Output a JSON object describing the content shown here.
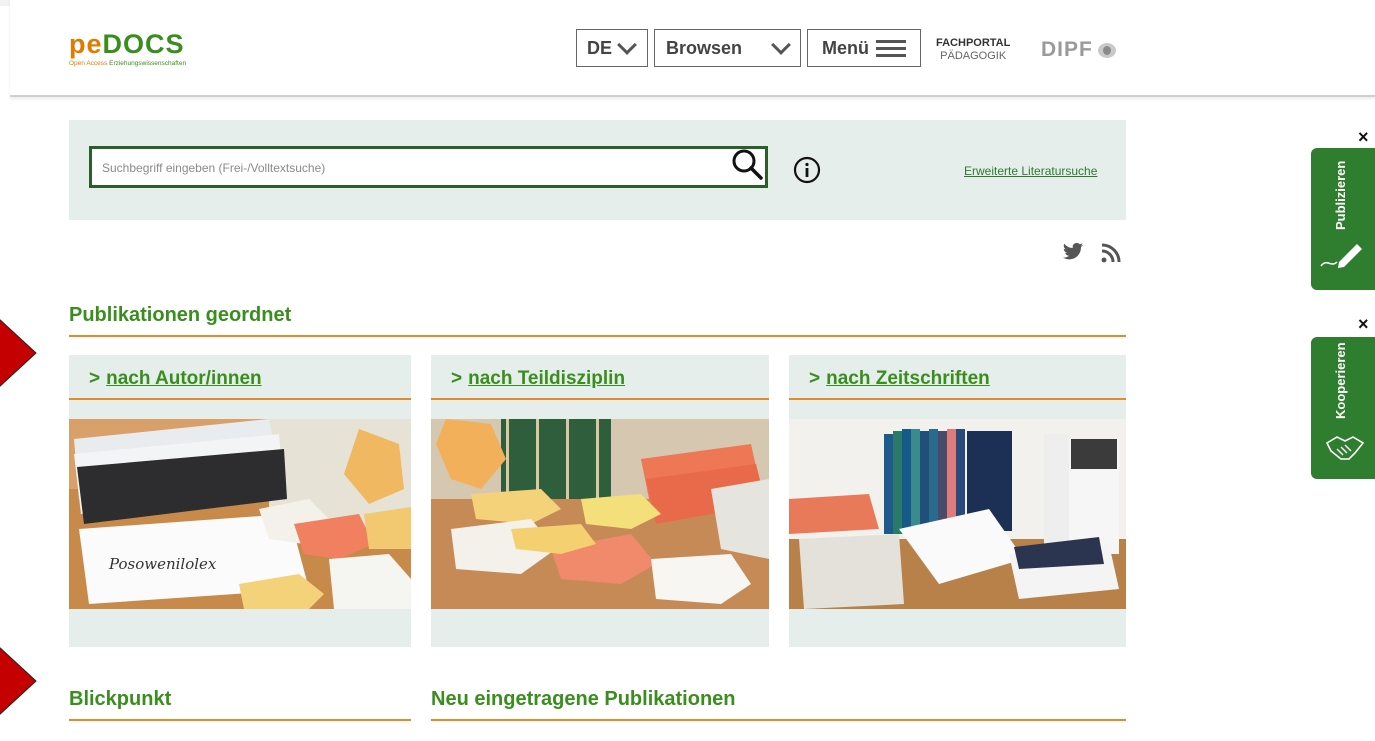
{
  "header": {
    "logo": {
      "pe": "pe",
      "docs": "DOCS",
      "sub_a": "Open Access ",
      "sub_b": "Erziehungswissenschaften"
    },
    "language": "DE",
    "browse_label": "Browsen",
    "menu_label": "Menü",
    "fachportal": {
      "line1": "FACHPORTAL",
      "line2": "PÄDAGOGIK"
    },
    "dipf": "DIPF"
  },
  "search": {
    "placeholder": "Suchbegriff eingeben (Frei-/Volltextsuche)",
    "advanced_link": "Erweiterte Literatursuche"
  },
  "publications": {
    "title": "Publikationen geordnet",
    "cards": [
      {
        "label": "nach Autor/innen"
      },
      {
        "label": "nach Teildisziplin"
      },
      {
        "label": "nach Zeitschriften"
      }
    ]
  },
  "blickpunkt": {
    "title": "Blickpunkt"
  },
  "neu": {
    "title": "Neu eingetragene Publikationen"
  },
  "side_tabs": {
    "publish": "Publizieren",
    "cooperate": "Kooperieren",
    "close_symbol": "×"
  },
  "colors": {
    "accent_green": "#3a8e1e",
    "accent_orange": "#e58a2a",
    "panel_bg": "#e6eeec",
    "tab_green": "#2f7d2f"
  },
  "icons": [
    "search-icon",
    "info-icon",
    "twitter-icon",
    "rss-icon",
    "pen-icon",
    "handshake-icon",
    "chevron-down-icon",
    "hamburger-icon"
  ]
}
